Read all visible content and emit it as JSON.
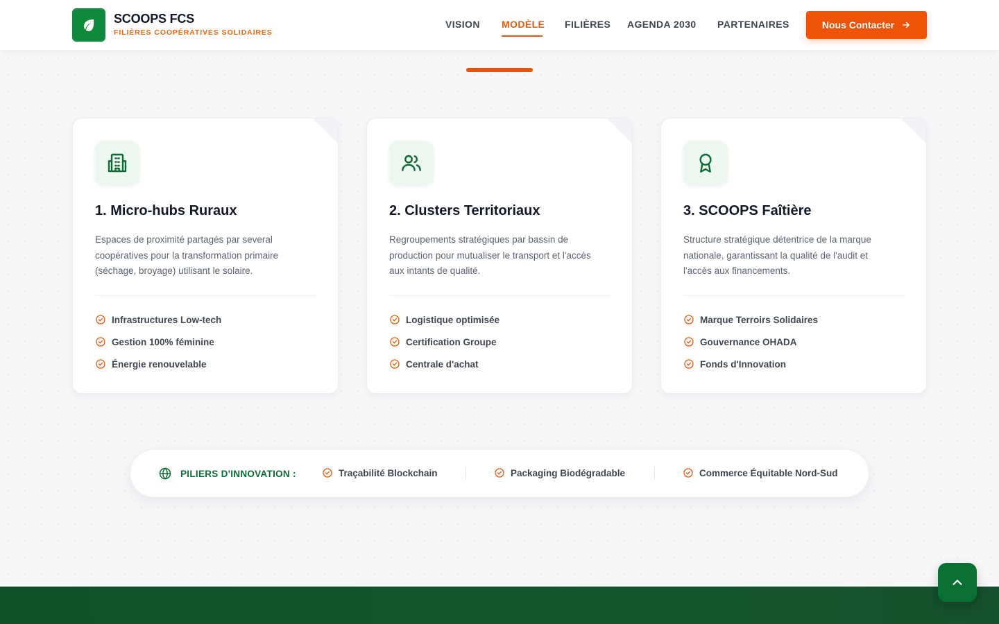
{
  "brand": {
    "title": "SCOOPS FCS",
    "subtitle": "FILIÈRES COOPÉRATIVES SOLIDAIRES",
    "logo_icon": "leaf-icon",
    "color": "#0f8a3c"
  },
  "nav": {
    "items": [
      "VISION",
      "MODÈLE",
      "FILIÈRES",
      "AGENDA 2030",
      "PARTENAIRES"
    ],
    "active": "MODÈLE",
    "cta_label": "Nous Contacter",
    "cta_icon": "arrow-right-icon",
    "accent_color": "#ee5308"
  },
  "cards": [
    {
      "icon": "building-icon",
      "title": "1. Micro-hubs Ruraux",
      "description": "Espaces de proximité partagés par several coopératives pour la transformation primaire (séchage, broyage) utilisant le solaire.",
      "features": [
        "Infrastructures Low-tech",
        "Gestion 100% féminine",
        "Énergie renouvelable"
      ]
    },
    {
      "icon": "users-icon",
      "title": "2. Clusters Territoriaux",
      "description": "Regroupements stratégiques par bassin de production pour mutualiser le transport et l'accès aux intants de qualité.",
      "features": [
        "Logistique optimisée",
        "Certification Groupe",
        "Centrale d'achat"
      ]
    },
    {
      "icon": "award-icon",
      "title": "3. SCOOPS Faîtière",
      "description": "Structure stratégique détentrice de la marque nationale, garantissant la qualité de l'audit et l'accès aux financements.",
      "features": [
        "Marque Terroirs Solidaires",
        "Gouvernance OHADA",
        "Fonds d'Innovation"
      ]
    }
  ],
  "pillars": {
    "label": "PILIERS D'INNOVATION :",
    "icon": "globe-icon",
    "items": [
      "Traçabilité Blockchain",
      "Packaging Biodégradable",
      "Commerce Équitable Nord-Sud"
    ]
  },
  "scroll_top_icon": "chevron-up-icon"
}
